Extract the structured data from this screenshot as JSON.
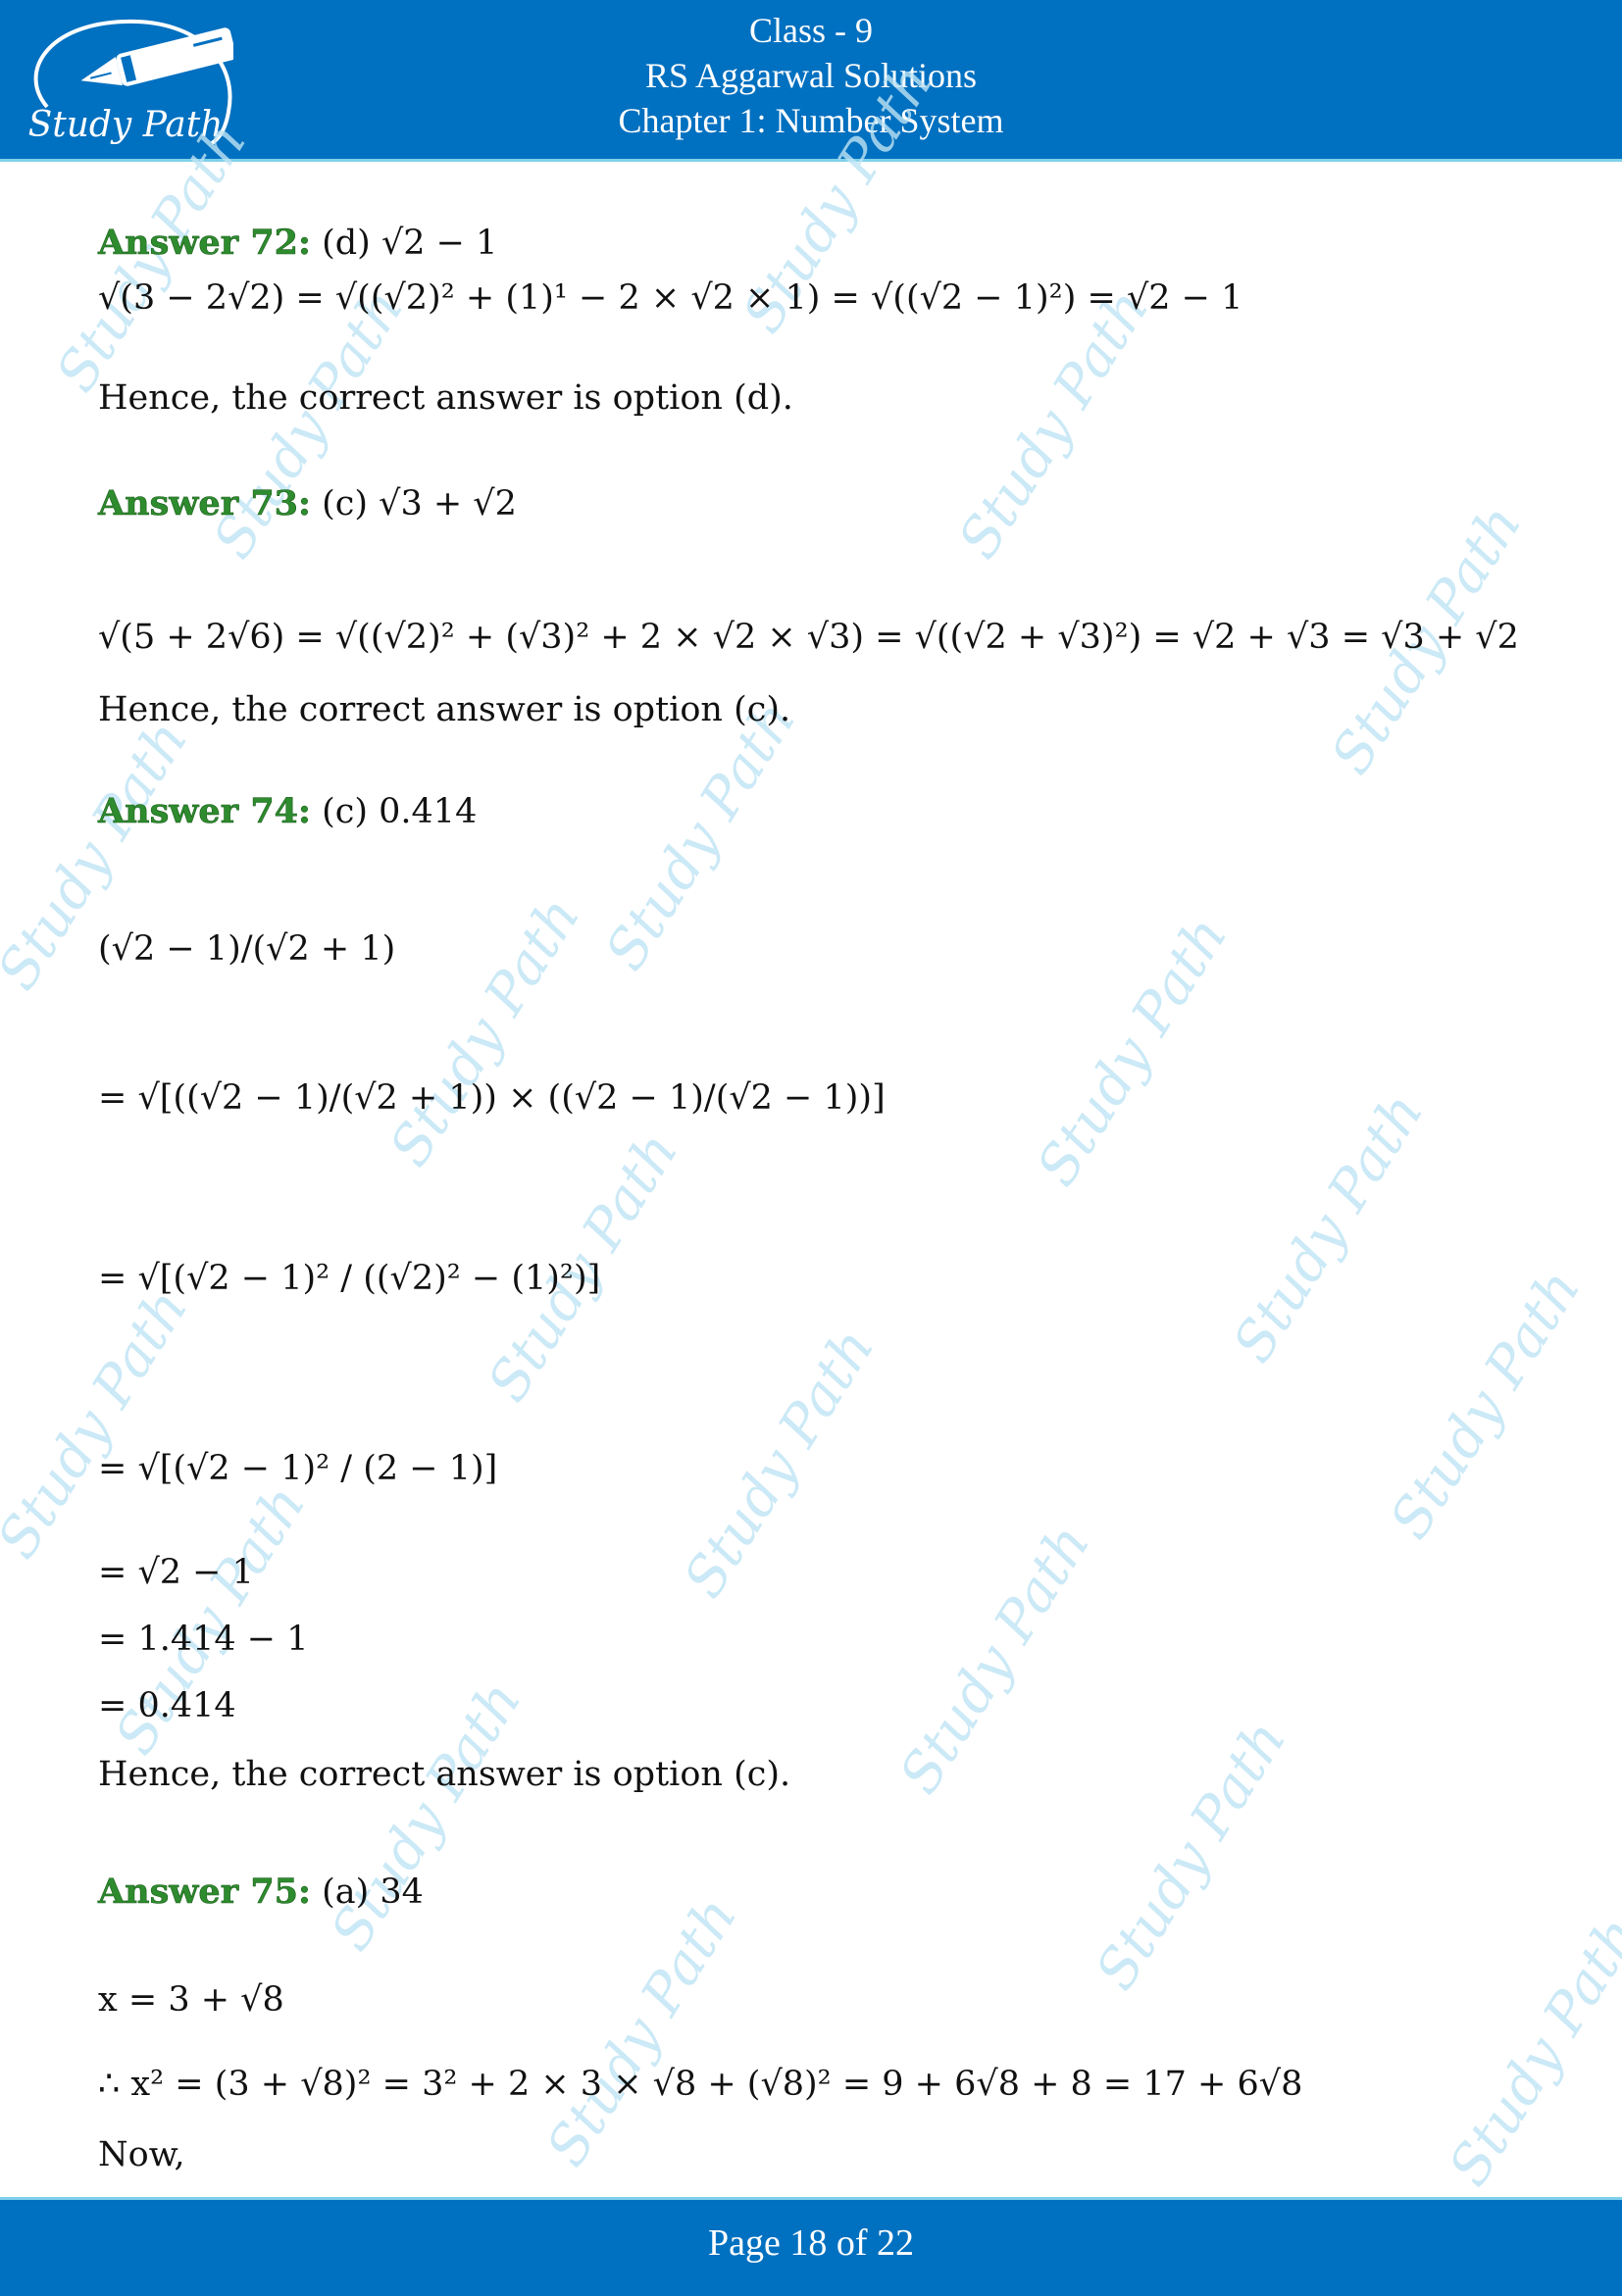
{
  "header": {
    "line1": "Class - 9",
    "line2": "RS Aggarwal Solutions",
    "line3": "Chapter 1: Number System",
    "logo_text": "Study Path",
    "bg_color": "#0070c0"
  },
  "watermark_text": "Study Path",
  "answers": [
    {
      "label": "Answer 72:",
      "choice": "(d) √2 − 1",
      "steps": [
        "√(3 − 2√2) = √((√2)² + (1)¹ − 2 × √2 × 1) = √((√2 − 1)²) = √2 − 1"
      ],
      "conclusion": "Hence, the correct answer is option (d)."
    },
    {
      "label": "Answer 73:",
      "choice": "(c) √3 + √2",
      "steps": [
        "√(5 + 2√6) = √((√2)² + (√3)² + 2 × √2 × √3) = √((√2 + √3)²) = √2 + √3 = √3 + √2"
      ],
      "conclusion": "Hence, the correct answer is option (c)."
    },
    {
      "label": "Answer 74:",
      "choice": "(c) 0.414",
      "steps": [
        "(√2 − 1)/(√2 + 1)",
        "= √[((√2 − 1)/(√2 + 1)) × ((√2 − 1)/(√2 − 1))]",
        "= √[(√2 − 1)² / ((√2)² − (1)²)]",
        "= √[(√2 − 1)² / (2 − 1)]",
        "= √2 − 1",
        "= 1.414 − 1",
        "= 0.414"
      ],
      "conclusion": "Hence, the correct answer is option (c)."
    },
    {
      "label": "Answer 75:",
      "choice": "(a) 34",
      "steps": [
        "x = 3 + √8",
        "∴ x² = (3 + √8)² = 3² + 2 × 3 × √8 + (√8)² = 9 + 6√8 + 8 = 17 + 6√8",
        "Now,"
      ]
    }
  ],
  "footer": {
    "page_text": "Page 18 of 22",
    "page_current": 18,
    "page_total": 22
  }
}
